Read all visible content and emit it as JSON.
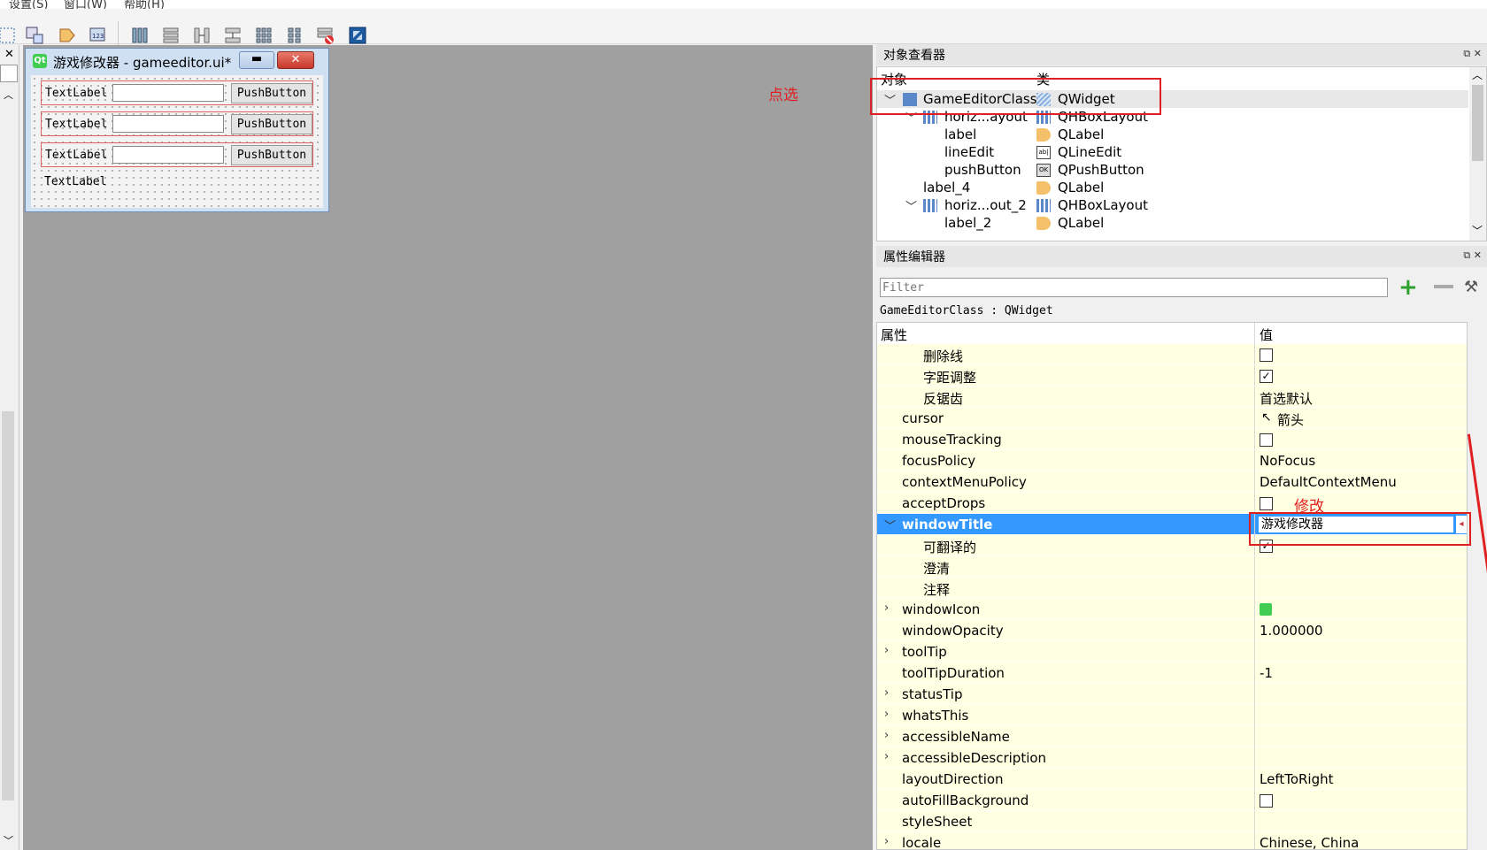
{
  "menubar": {
    "settings": "设置(S)",
    "window": "窗口(W)",
    "help": "帮助(H)"
  },
  "toolbar": {
    "icons": [
      "edit-widgets-icon",
      "edit-signals-icon",
      "edit-buddies-icon",
      "edit-tab-order-icon",
      "layout-horizontal-icon",
      "layout-vertical-icon",
      "layout-h-splitter-icon",
      "layout-v-splitter-icon",
      "layout-grid-icon",
      "layout-form-icon",
      "break-layout-icon",
      "adjust-size-icon"
    ]
  },
  "form": {
    "title": "游戏修改器 - gameeditor.ui*",
    "rows": [
      {
        "label": "TextLabel",
        "button": "PushButton"
      },
      {
        "label": "TextLabel",
        "button": "PushButton"
      },
      {
        "label": "TextLabel",
        "button": "PushButton"
      }
    ],
    "bottom_label": "TextLabel"
  },
  "object_inspector": {
    "title": "对象查看器",
    "col_object": "对象",
    "col_class": "类",
    "annotation": "点选",
    "rows": [
      {
        "name": "GameEditorClass",
        "cls": "QWidget"
      },
      {
        "name": "horiz...ayout",
        "cls": "QHBoxLayout"
      },
      {
        "name": "label",
        "cls": "QLabel"
      },
      {
        "name": "lineEdit",
        "cls": "QLineEdit"
      },
      {
        "name": "pushButton",
        "cls": "QPushButton"
      },
      {
        "name": "label_4",
        "cls": "QLabel"
      },
      {
        "name": "horiz...out_2",
        "cls": "QHBoxLayout"
      },
      {
        "name": "label_2",
        "cls": "QLabel"
      }
    ]
  },
  "property_editor": {
    "title": "属性编辑器",
    "filter_placeholder": "Filter",
    "class_line": "GameEditorClass : QWidget",
    "col_property": "属性",
    "col_value": "值",
    "annotation": "修改",
    "rows": [
      {
        "name": "删除线",
        "value": "",
        "check": "off"
      },
      {
        "name": "字距调整",
        "value": "",
        "check": "on"
      },
      {
        "name": "反锯齿",
        "value": "首选默认"
      },
      {
        "name": "cursor",
        "value": "箭头"
      },
      {
        "name": "mouseTracking",
        "value": "",
        "check": "off"
      },
      {
        "name": "focusPolicy",
        "value": "NoFocus"
      },
      {
        "name": "contextMenuPolicy",
        "value": "DefaultContextMenu"
      },
      {
        "name": "acceptDrops",
        "value": "",
        "check": "off"
      },
      {
        "name": "windowTitle",
        "value": "游戏修改器"
      },
      {
        "name": "可翻译的",
        "value": "",
        "check": "on"
      },
      {
        "name": "澄清",
        "value": ""
      },
      {
        "name": "注释",
        "value": ""
      },
      {
        "name": "windowIcon",
        "value": ""
      },
      {
        "name": "windowOpacity",
        "value": "1.000000"
      },
      {
        "name": "toolTip",
        "value": ""
      },
      {
        "name": "toolTipDuration",
        "value": "-1"
      },
      {
        "name": "statusTip",
        "value": ""
      },
      {
        "name": "whatsThis",
        "value": ""
      },
      {
        "name": "accessibleName",
        "value": ""
      },
      {
        "name": "accessibleDescription",
        "value": ""
      },
      {
        "name": "layoutDirection",
        "value": "LeftToRight"
      },
      {
        "name": "autoFillBackground",
        "value": "",
        "check": "off"
      },
      {
        "name": "styleSheet",
        "value": ""
      },
      {
        "name": "locale",
        "value": "Chinese, China"
      }
    ]
  },
  "colors": {
    "accent": "#3399ff",
    "row_yellow": "#ffffe1",
    "annotation_red": "#e02020"
  }
}
